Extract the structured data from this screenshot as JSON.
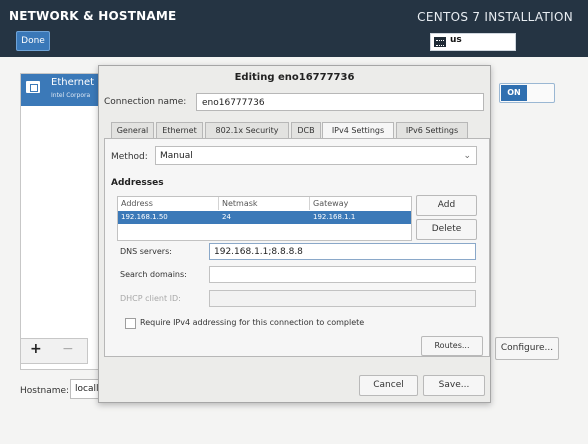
{
  "header": {
    "title": "NETWORK & HOSTNAME",
    "done_label": "Done",
    "install_title": "CENTOS 7 INSTALLATION",
    "keyboard_layout": "us"
  },
  "left_pane": {
    "device_name": "Ethernet",
    "device_sub": "Intel Corpora",
    "add_label": "+",
    "remove_label": "−"
  },
  "hostname": {
    "label": "Hostname:",
    "value": "locall"
  },
  "toggle": {
    "state_label": "ON"
  },
  "configure_label": "Configure...",
  "dialog": {
    "title": "Editing eno16777736",
    "connection_name_label": "Connection name:",
    "connection_name_value": "eno16777736",
    "tabs": [
      {
        "label": "General"
      },
      {
        "label": "Ethernet"
      },
      {
        "label": "802.1x Security"
      },
      {
        "label": "DCB"
      },
      {
        "label": "IPv4 Settings"
      },
      {
        "label": "IPv6 Settings"
      }
    ],
    "active_tab": "IPv4 Settings",
    "method_label": "Method:",
    "method_value": "Manual",
    "addresses_heading": "Addresses",
    "table_headers": [
      "Address",
      "Netmask",
      "Gateway"
    ],
    "rows": [
      {
        "address": "192.168.1.50",
        "netmask": "24",
        "gateway": "192.168.1.1"
      }
    ],
    "add_label": "Add",
    "delete_label": "Delete",
    "dns_label": "DNS servers:",
    "dns_value": "192.168.1.1;8.8.8.8",
    "search_label": "Search domains:",
    "search_value": "",
    "dhcp_label": "DHCP client ID:",
    "dhcp_value": "",
    "require_label": "Require IPv4 addressing for this connection to complete",
    "routes_label": "Routes...",
    "cancel_label": "Cancel",
    "save_label": "Save..."
  },
  "colors": {
    "header_bg": "#253443",
    "selection_blue": "#3b79b8",
    "toggle_blue": "#2f6fb0"
  }
}
